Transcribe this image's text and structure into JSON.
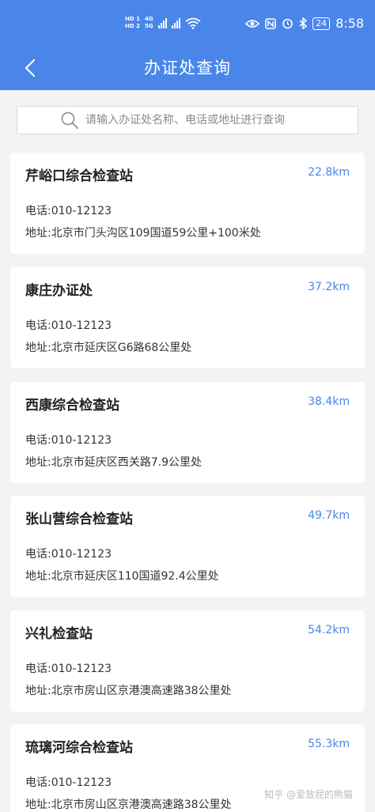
{
  "status_bar": {
    "left_tags": [
      "HD 1",
      "HD 2"
    ],
    "network": [
      "4G",
      "5G"
    ],
    "battery": "24",
    "time": "8:58"
  },
  "nav": {
    "title": "办证处查询"
  },
  "search": {
    "placeholder": "请输入办证处名称、电话或地址进行查询"
  },
  "stations": [
    {
      "name": "芹峪口综合检查站",
      "distance": "22.8km",
      "phone": "电话:010-12123",
      "address": "地址:北京市门头沟区109国道59公里+100米处"
    },
    {
      "name": "康庄办证处",
      "distance": "37.2km",
      "phone": "电话:010-12123",
      "address": "地址:北京市延庆区G6路68公里处"
    },
    {
      "name": "西康综合检查站",
      "distance": "38.4km",
      "phone": "电话:010-12123",
      "address": "地址:北京市延庆区西关路7.9公里处"
    },
    {
      "name": "张山营综合检查站",
      "distance": "49.7km",
      "phone": "电话:010-12123",
      "address": "地址:北京市延庆区110国道92.4公里处"
    },
    {
      "name": "兴礼检查站",
      "distance": "54.2km",
      "phone": "电话:010-12123",
      "address": "地址:北京市房山区京港澳高速路38公里处"
    },
    {
      "name": "琉璃河综合检查站",
      "distance": "55.3km",
      "phone": "电话:010-12123",
      "address": "地址:北京市房山区京港澳高速路38公里处"
    }
  ],
  "watermark": "知乎 @爱放屁的熊猫",
  "colors": {
    "accent": "#4a86ea",
    "background": "#f2f3f5",
    "card": "#ffffff"
  }
}
